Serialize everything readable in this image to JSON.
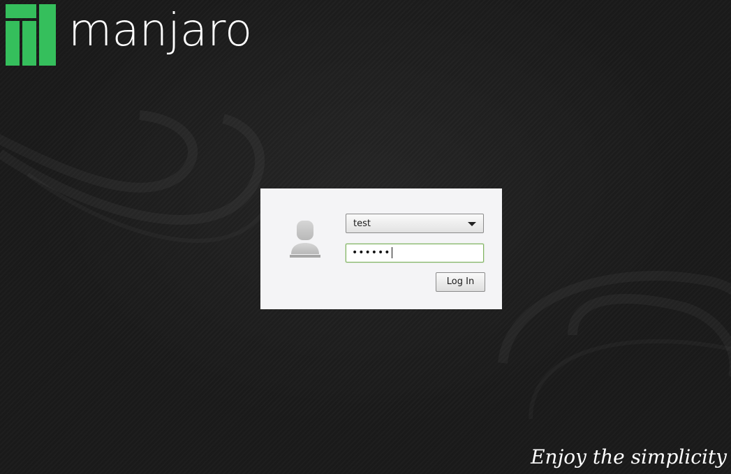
{
  "branding": {
    "name": "manjaro",
    "logo_icon": "manjaro-logo-icon",
    "logo_color": "#35bf5c",
    "tagline": "Enjoy the simplicity"
  },
  "login": {
    "avatar_icon": "user-avatar-icon",
    "selected_user": "test",
    "user_dropdown_icon": "chevron-down-icon",
    "password_value": "••••••",
    "focus_color": "#7fb360",
    "login_button_label": "Log In"
  },
  "colors": {
    "background": "#1a1a1a",
    "panel": "#f4f4f6"
  }
}
